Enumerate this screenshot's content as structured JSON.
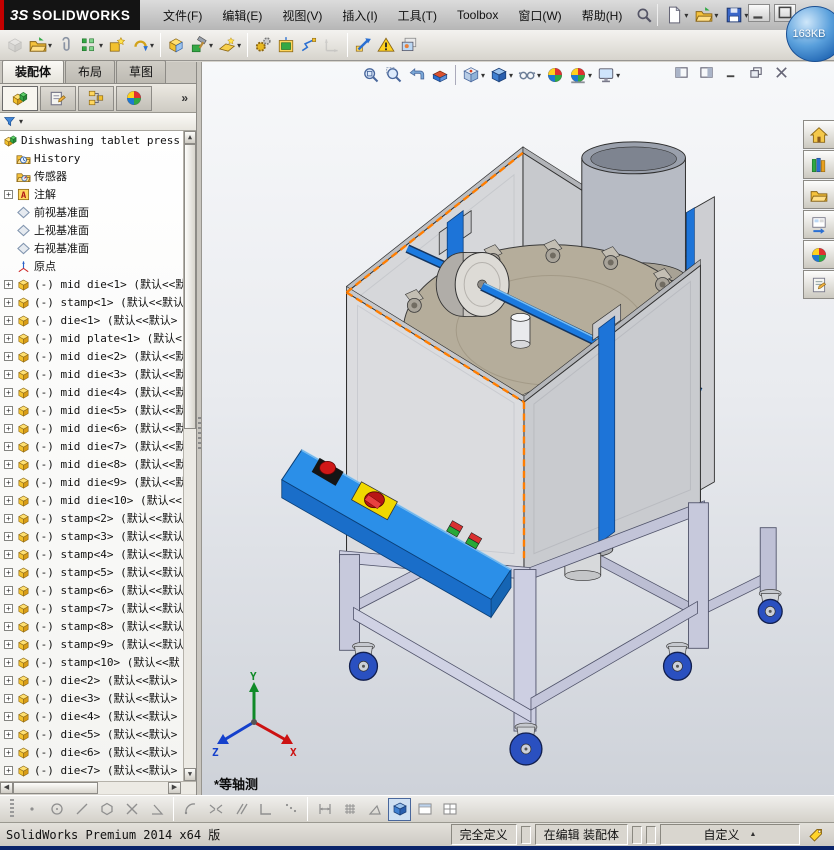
{
  "titlebar": {
    "logo_mark": "3S",
    "logo": "SOLIDWORKS",
    "menus": [
      "文件(F)",
      "编辑(E)",
      "视图(V)",
      "插入(I)",
      "工具(T)",
      "Toolbox",
      "窗口(W)",
      "帮助(H)"
    ],
    "quick": [
      {
        "icon": "new-doc",
        "caret": true
      },
      {
        "icon": "open-doc",
        "caret": true
      },
      {
        "icon": "save-doc",
        "caret": true
      },
      {
        "icon": "print-doc",
        "disabled": true
      },
      {
        "icon": "help",
        "caret": true
      }
    ],
    "window_controls": [
      {
        "icon": "win-minimize"
      },
      {
        "icon": "win-maximize"
      }
    ],
    "badge": "163KB"
  },
  "command_tabs": [
    {
      "label": "装配体",
      "active": true
    },
    {
      "label": "布局",
      "active": false
    },
    {
      "label": "草图",
      "active": false
    }
  ],
  "assembly_toolbar": [
    {
      "icon": "insert-components",
      "disabled": true
    },
    {
      "icon": "open-in-context",
      "caret": true
    },
    {
      "icon": "mate"
    },
    {
      "icon": "linear-component-pattern",
      "caret": true
    },
    {
      "icon": "smart-fasteners"
    },
    {
      "icon": "move-component",
      "caret": true
    },
    {
      "sep": true
    },
    {
      "icon": "show-hidden-components"
    },
    {
      "icon": "assembly-features",
      "caret": true
    },
    {
      "icon": "reference-geometry",
      "caret": true
    },
    {
      "sep": true
    },
    {
      "icon": "new-motion-study"
    },
    {
      "icon": "exploded-view"
    },
    {
      "icon": "explode-line-sketch"
    },
    {
      "icon": "instant3d",
      "disabled": true
    },
    {
      "sep": true
    },
    {
      "icon": "interference-detection"
    },
    {
      "icon": "assembly-visualization"
    },
    {
      "icon": "screen-capture"
    }
  ],
  "headsup_toolbar": [
    {
      "icon": "zoom-fit"
    },
    {
      "icon": "zoom-area"
    },
    {
      "icon": "previous-view"
    },
    {
      "icon": "section-view"
    },
    {
      "sep": true
    },
    {
      "icon": "view-orientation",
      "caret": true
    },
    {
      "icon": "display-style",
      "caret": true
    },
    {
      "icon": "hide-show-items",
      "caret": true
    },
    {
      "icon": "edit-appearance"
    },
    {
      "icon": "apply-scene",
      "caret": true
    },
    {
      "icon": "view-settings",
      "caret": true
    }
  ],
  "doc_controls": [
    {
      "icon": "pane-left"
    },
    {
      "icon": "pane-right"
    },
    {
      "icon": "win-minimize"
    },
    {
      "icon": "win-restore"
    },
    {
      "icon": "win-close"
    }
  ],
  "feature_manager": {
    "tabs": [
      {
        "icon": "fm-tree",
        "active": true
      },
      {
        "icon": "fm-properties",
        "active": false
      },
      {
        "icon": "fm-configurations",
        "active": false
      },
      {
        "icon": "fm-display",
        "active": false
      }
    ],
    "overflow": "»"
  },
  "feature_tree": [
    {
      "icon": "assembly-root",
      "label": "Dishwashing tablet press",
      "root": true
    },
    {
      "icon": "history",
      "label": "History"
    },
    {
      "icon": "sensors",
      "label": "传感器"
    },
    {
      "icon": "annotations",
      "label": "注解",
      "expand": true
    },
    {
      "icon": "plane",
      "label": "前视基准面"
    },
    {
      "icon": "plane",
      "label": "上视基准面"
    },
    {
      "icon": "plane",
      "label": "右视基准面"
    },
    {
      "icon": "origin",
      "label": "原点"
    },
    {
      "icon": "part",
      "label": "(-) mid die<1> (默认<<默",
      "expand": true
    },
    {
      "icon": "part",
      "label": "(-) stamp<1> (默认<<默认",
      "expand": true
    },
    {
      "icon": "part",
      "label": "(-) die<1> (默认<<默认>",
      "expand": true
    },
    {
      "icon": "part",
      "label": "(-) mid plate<1> (默认<",
      "expand": true
    },
    {
      "icon": "part",
      "label": "(-) mid die<2> (默认<<默",
      "expand": true
    },
    {
      "icon": "part",
      "label": "(-) mid die<3> (默认<<默",
      "expand": true
    },
    {
      "icon": "part",
      "label": "(-) mid die<4> (默认<<默",
      "expand": true
    },
    {
      "icon": "part",
      "label": "(-) mid die<5> (默认<<默",
      "expand": true
    },
    {
      "icon": "part",
      "label": "(-) mid die<6> (默认<<默",
      "expand": true
    },
    {
      "icon": "part",
      "label": "(-) mid die<7> (默认<<默",
      "expand": true
    },
    {
      "icon": "part",
      "label": "(-) mid die<8> (默认<<默",
      "expand": true
    },
    {
      "icon": "part",
      "label": "(-) mid die<9> (默认<<默",
      "expand": true
    },
    {
      "icon": "part",
      "label": "(-) mid die<10> (默认<<",
      "expand": true
    },
    {
      "icon": "part",
      "label": "(-) stamp<2> (默认<<默认",
      "expand": true
    },
    {
      "icon": "part",
      "label": "(-) stamp<3> (默认<<默认",
      "expand": true
    },
    {
      "icon": "part",
      "label": "(-) stamp<4> (默认<<默认",
      "expand": true
    },
    {
      "icon": "part",
      "label": "(-) stamp<5> (默认<<默认",
      "expand": true
    },
    {
      "icon": "part",
      "label": "(-) stamp<6> (默认<<默认",
      "expand": true
    },
    {
      "icon": "part",
      "label": "(-) stamp<7> (默认<<默认",
      "expand": true
    },
    {
      "icon": "part",
      "label": "(-) stamp<8> (默认<<默认",
      "expand": true
    },
    {
      "icon": "part",
      "label": "(-) stamp<9> (默认<<默认",
      "expand": true
    },
    {
      "icon": "part",
      "label": "(-) stamp<10> (默认<<默",
      "expand": true
    },
    {
      "icon": "part",
      "label": "(-) die<2> (默认<<默认>",
      "expand": true
    },
    {
      "icon": "part",
      "label": "(-) die<3> (默认<<默认>",
      "expand": true
    },
    {
      "icon": "part",
      "label": "(-) die<4> (默认<<默认>",
      "expand": true
    },
    {
      "icon": "part",
      "label": "(-) die<5> (默认<<默认>",
      "expand": true
    },
    {
      "icon": "part",
      "label": "(-) die<6> (默认<<默认>",
      "expand": true
    },
    {
      "icon": "part",
      "label": "(-) die<7> (默认<<默认>",
      "expand": true
    }
  ],
  "task_pane": [
    {
      "icon": "tp-resources"
    },
    {
      "icon": "tp-design-library"
    },
    {
      "icon": "tp-file-explorer"
    },
    {
      "icon": "tp-view-palette"
    },
    {
      "icon": "tp-appearances"
    },
    {
      "icon": "tp-custom-properties"
    }
  ],
  "viewport": {
    "view_label": "*等轴测",
    "triad": {
      "x": "X",
      "y": "Y",
      "z": "Z"
    }
  },
  "sketch_toolbar": [
    {
      "icon": "sk-point"
    },
    {
      "icon": "sk-circle"
    },
    {
      "icon": "sk-line"
    },
    {
      "icon": "sk-polygon"
    },
    {
      "icon": "sk-trim"
    },
    {
      "icon": "sk-angle"
    },
    {
      "sep": true
    },
    {
      "icon": "sk-arc"
    },
    {
      "icon": "sk-converge"
    },
    {
      "icon": "sk-parallel"
    },
    {
      "icon": "sk-corner"
    },
    {
      "icon": "sk-points"
    },
    {
      "sep": true
    },
    {
      "icon": "sk-dimension"
    },
    {
      "icon": "sk-grid"
    },
    {
      "icon": "sk-triangle"
    },
    {
      "icon": "sk-shaded",
      "active": true
    },
    {
      "icon": "sk-view-single"
    },
    {
      "icon": "sk-view-split"
    }
  ],
  "status_bar": {
    "left": "SolidWorks Premium 2014 x64 版",
    "defined": "完全定义",
    "editing": "在编辑 装配体",
    "custom": "自定义"
  }
}
